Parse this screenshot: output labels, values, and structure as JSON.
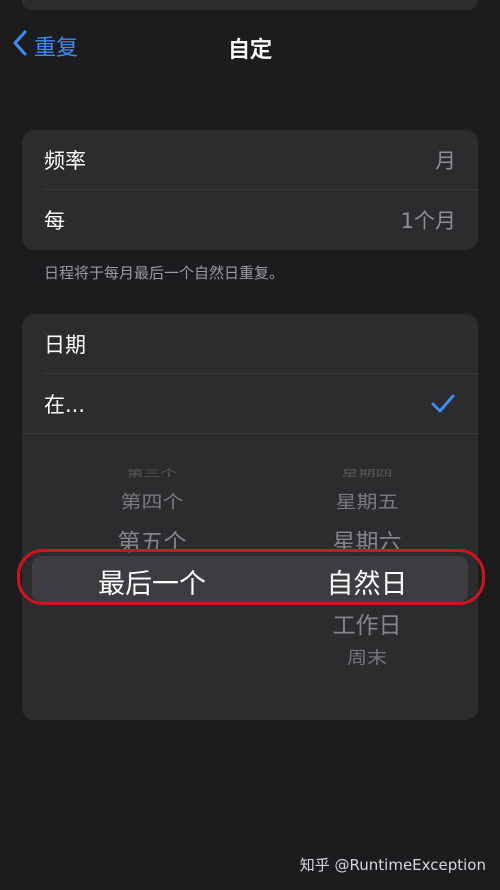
{
  "nav": {
    "back_label": "重复",
    "title": "自定"
  },
  "frequency_card": {
    "rows": [
      {
        "label": "频率",
        "value": "月"
      },
      {
        "label": "每",
        "value": "1个月"
      }
    ]
  },
  "footnote": "日程将于每月最后一个自然日重复。",
  "date_card": {
    "rows": [
      {
        "label": "日期"
      },
      {
        "label": "在..."
      }
    ],
    "picker": {
      "left_column": [
        "第三个",
        "第四个",
        "第五个",
        "最后一个"
      ],
      "left_selected": "最后一个",
      "right_column": [
        "星期四",
        "星期五",
        "星期六",
        "自然日",
        "工作日",
        "周末"
      ],
      "right_selected": "自然日"
    }
  },
  "watermark": "知乎 @RuntimeException",
  "colors": {
    "accent": "#3b8cf5",
    "annotation": "#d4121e"
  },
  "icons": {
    "back": "chevron-left-icon",
    "check": "checkmark-icon"
  }
}
